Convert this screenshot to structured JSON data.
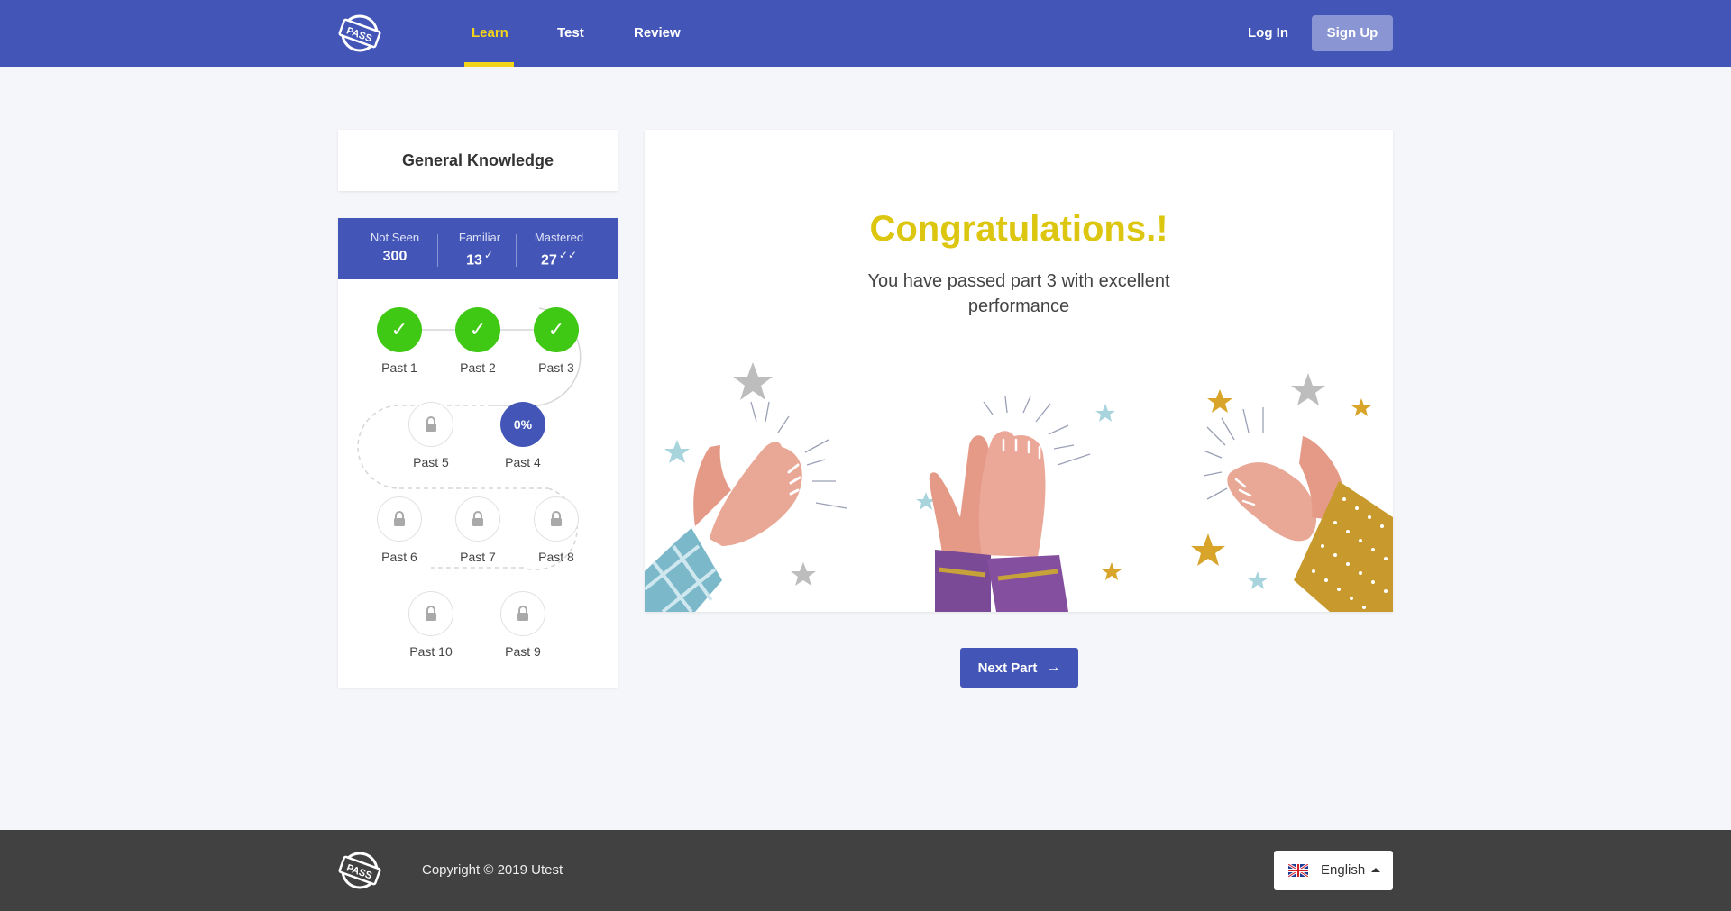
{
  "header": {
    "logo_text": "PASS",
    "nav": [
      {
        "label": "Learn",
        "active": true
      },
      {
        "label": "Test",
        "active": false
      },
      {
        "label": "Review",
        "active": false
      }
    ],
    "login_label": "Log In",
    "signup_label": "Sign Up"
  },
  "sidebar": {
    "subject_title": "General Knowledge",
    "stats": [
      {
        "label": "Not Seen",
        "value": "300",
        "check": ""
      },
      {
        "label": "Familiar",
        "value": "13",
        "check": "✓"
      },
      {
        "label": "Mastered",
        "value": "27",
        "check": "✓✓"
      }
    ],
    "parts": [
      {
        "label": "Past 1",
        "state": "done",
        "icon": "check-icon"
      },
      {
        "label": "Past 2",
        "state": "done",
        "icon": "check-icon"
      },
      {
        "label": "Past 3",
        "state": "done",
        "icon": "check-icon"
      },
      {
        "label": "Past 4",
        "state": "current",
        "progress_text": "0%"
      },
      {
        "label": "Past 5",
        "state": "locked",
        "icon": "lock-icon"
      },
      {
        "label": "Past 6",
        "state": "locked",
        "icon": "lock-icon"
      },
      {
        "label": "Past 7",
        "state": "locked",
        "icon": "lock-icon"
      },
      {
        "label": "Past 8",
        "state": "locked",
        "icon": "lock-icon"
      },
      {
        "label": "Past 9",
        "state": "locked",
        "icon": "lock-icon"
      },
      {
        "label": "Past 10",
        "state": "locked",
        "icon": "lock-icon"
      }
    ]
  },
  "main": {
    "title": "Congratulations.!",
    "message": "You have passed part 3 with excellent performance",
    "illustration": "clapping-hands-illustration",
    "next_label": "Next Part",
    "next_icon": "arrow-right-icon"
  },
  "footer": {
    "logo_text": "PASS",
    "copyright": "Copyright © 2019 Utest",
    "language": "English",
    "flag_icon": "uk-flag-icon"
  },
  "colors": {
    "primary": "#4356b7",
    "accent": "#f4d31b",
    "success": "#3fc814",
    "congrats": "#dcc60f",
    "footer": "#414141"
  }
}
